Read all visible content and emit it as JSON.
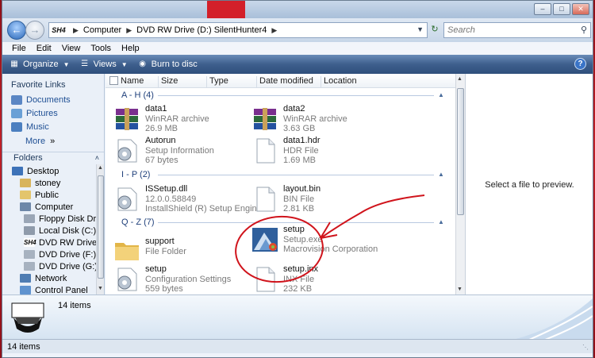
{
  "window": {
    "title_buttons": [
      "minimize",
      "maximize",
      "close"
    ]
  },
  "address": {
    "drive_badge": "SH4",
    "crumbs": [
      "Computer",
      "DVD RW Drive (D:) SilentHunter4"
    ],
    "search_placeholder": "Search"
  },
  "menu": [
    "File",
    "Edit",
    "View",
    "Tools",
    "Help"
  ],
  "commands": {
    "organize": "Organize",
    "views": "Views",
    "burn": "Burn to disc"
  },
  "nav": {
    "favorite_links_label": "Favorite Links",
    "favorites": [
      "Documents",
      "Pictures",
      "Music"
    ],
    "more_label": "More",
    "folders_label": "Folders",
    "tree": [
      "Desktop",
      "stoney",
      "Public",
      "Computer",
      "Floppy Disk Drive",
      "Local Disk (C:)",
      "DVD RW Drive (D:)",
      "DVD Drive (F:)",
      "DVD Drive (G:)",
      "Network",
      "Control Panel"
    ],
    "tree_badge": "SH4"
  },
  "columns": [
    "Name",
    "Size",
    "Type",
    "Date modified",
    "Location"
  ],
  "groups": [
    {
      "label": "A - H (4)"
    },
    {
      "label": "I - P (2)"
    },
    {
      "label": "Q - Z (7)"
    }
  ],
  "items": [
    {
      "name": "data1",
      "type": "WinRAR archive",
      "size": "26.9 MB",
      "icon": "winrar-icon"
    },
    {
      "name": "data2",
      "type": "WinRAR archive",
      "size": "3.63 GB",
      "icon": "winrar-icon"
    },
    {
      "name": "Autorun",
      "type": "Setup Information",
      "size": "67 bytes",
      "icon": "settings-file-icon"
    },
    {
      "name": "data1.hdr",
      "type": "HDR File",
      "size": "1.69 MB",
      "icon": "blank-file-icon"
    },
    {
      "name": "ISSetup.dll",
      "type": "12.0.0.58849",
      "size": "InstallShield (R) Setup Engine",
      "icon": "dll-file-icon"
    },
    {
      "name": "layout.bin",
      "type": "BIN File",
      "size": "2.81 KB",
      "icon": "blank-file-icon"
    },
    {
      "name": "support",
      "type": "File Folder",
      "size": "",
      "icon": "folder-icon"
    },
    {
      "name": "setup",
      "type": "Setup.exe",
      "size": "Macrovision Corporation",
      "icon": "setup-exe-icon"
    },
    {
      "name": "setup",
      "type": "Configuration Settings",
      "size": "559 bytes",
      "icon": "settings-file-icon"
    },
    {
      "name": "setup.inx",
      "type": "INX File",
      "size": "232 KB",
      "icon": "blank-file-icon"
    }
  ],
  "preview_text": "Select a file to preview.",
  "details": {
    "count": "14 items"
  },
  "status": {
    "text": "14 items"
  },
  "colors": {
    "accent": "#1e4f94",
    "command_bar": "#3e5f8d",
    "annotation": "#d0141c"
  }
}
